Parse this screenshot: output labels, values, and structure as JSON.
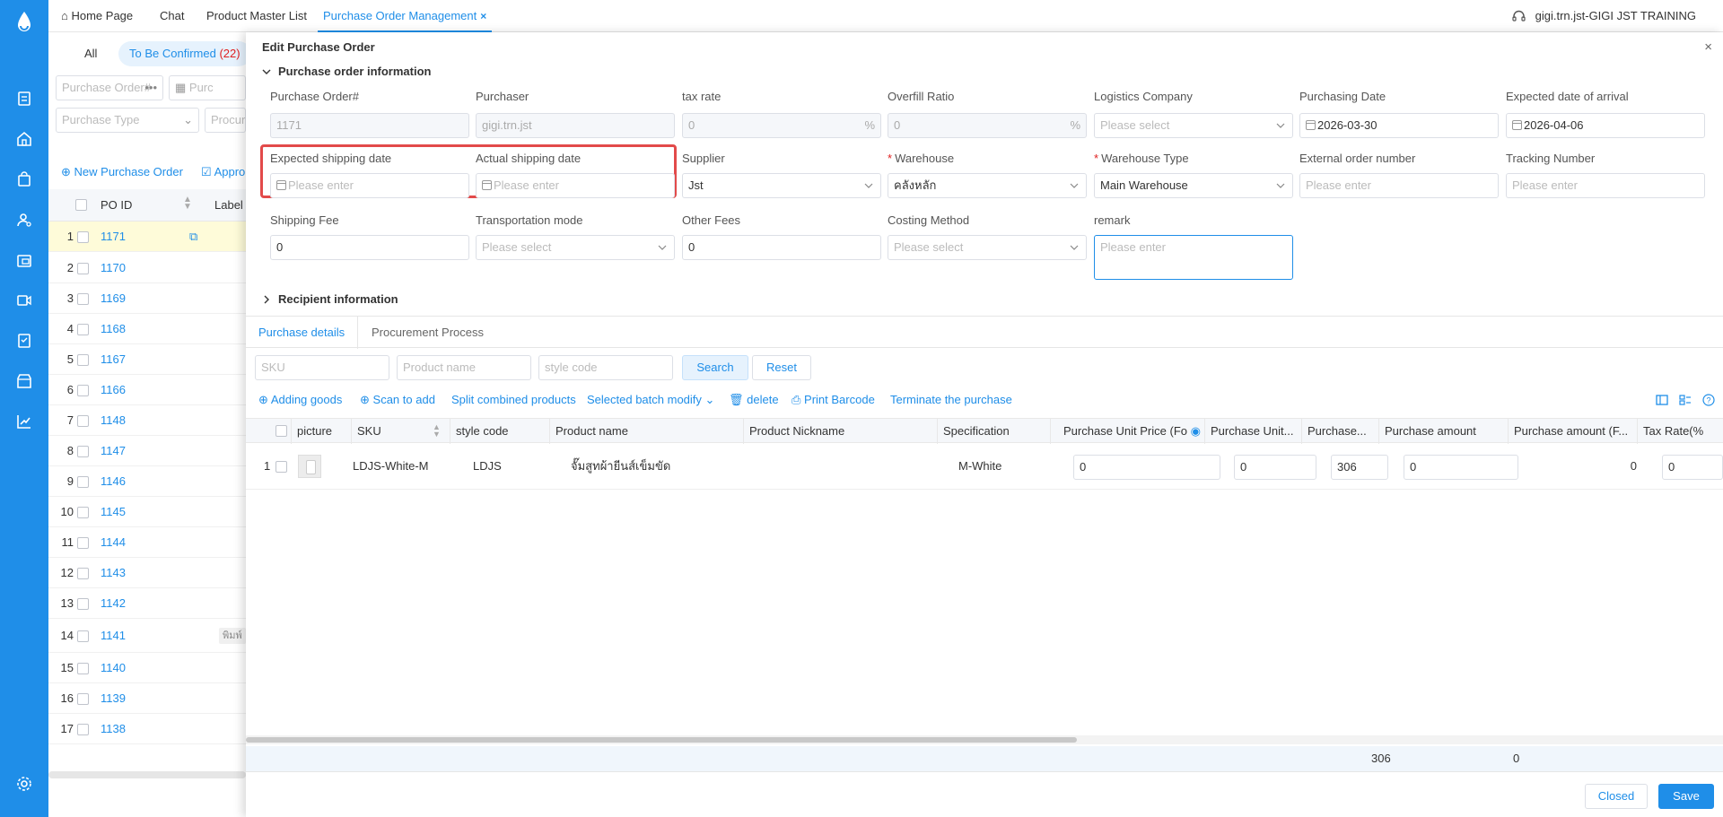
{
  "topbar": {
    "tabs": [
      "Home Page",
      "Chat",
      "Product Master List",
      "Purchase Order Management"
    ],
    "active_tab_close": "×",
    "user": "gigi.trn.jst-GIGI JST TRAINING"
  },
  "list": {
    "filter_all": "All",
    "filter_confirm": "To Be Confirmed",
    "filter_confirm_count": "(22)",
    "po_search_placeholder": "Purchase Order#",
    "date_placeholder": "Purc",
    "type_placeholder": "Purchase Type",
    "procure_placeholder": "Procurem",
    "new_po": "New Purchase Order",
    "approve": "Appro",
    "col_po": "PO ID",
    "col_label": "Label",
    "rows": [
      {
        "n": "1",
        "id": "1171"
      },
      {
        "n": "2",
        "id": "1170"
      },
      {
        "n": "3",
        "id": "1169"
      },
      {
        "n": "4",
        "id": "1168"
      },
      {
        "n": "5",
        "id": "1167"
      },
      {
        "n": "6",
        "id": "1166"
      },
      {
        "n": "7",
        "id": "1148"
      },
      {
        "n": "8",
        "id": "1147"
      },
      {
        "n": "9",
        "id": "1146"
      },
      {
        "n": "10",
        "id": "1145"
      },
      {
        "n": "11",
        "id": "1144"
      },
      {
        "n": "12",
        "id": "1143"
      },
      {
        "n": "13",
        "id": "1142"
      },
      {
        "n": "14",
        "id": "1141",
        "label": "พิมพ์"
      },
      {
        "n": "15",
        "id": "1140"
      },
      {
        "n": "16",
        "id": "1139"
      },
      {
        "n": "17",
        "id": "1138"
      }
    ]
  },
  "drawer": {
    "title": "Edit Purchase Order",
    "close": "×",
    "section_info": "Purchase order information",
    "section_recipient": "Recipient information",
    "fields": {
      "po_label": "Purchase Order#",
      "po_value": "1171",
      "purchaser_label": "Purchaser",
      "purchaser_value": "gigi.trn.jst",
      "tax_label": "tax rate",
      "tax_value": "0",
      "tax_suffix": "%",
      "overfill_label": "Overfill Ratio",
      "overfill_value": "0",
      "overfill_suffix": "%",
      "logistics_label": "Logistics Company",
      "logistics_placeholder": "Please select",
      "pdate_label": "Purchasing Date",
      "pdate_value": "2026-03-30",
      "arrival_label": "Expected date of arrival",
      "arrival_value": "2026-04-06",
      "exp_ship_label": "Expected shipping date",
      "exp_ship_placeholder": "Please enter",
      "act_ship_label": "Actual shipping date",
      "act_ship_placeholder": "Please enter",
      "supplier_label": "Supplier",
      "supplier_value": "Jst",
      "warehouse_label": "Warehouse",
      "warehouse_value": "คลังหลัก",
      "wtype_label": "Warehouse Type",
      "wtype_value": "Main Warehouse",
      "ext_label": "External order number",
      "ext_placeholder": "Please enter",
      "tracking_label": "Tracking Number",
      "tracking_placeholder": "Please enter",
      "shipfee_label": "Shipping Fee",
      "shipfee_value": "0",
      "trans_label": "Transportation mode",
      "trans_placeholder": "Please select",
      "other_label": "Other Fees",
      "other_value": "0",
      "costing_label": "Costing Method",
      "costing_placeholder": "Please select",
      "remark_label": "remark",
      "remark_placeholder": "Please enter",
      "required_mark": "*"
    },
    "detail_tabs": [
      "Purchase details",
      "Procurement Process"
    ],
    "search": {
      "sku_placeholder": "SKU",
      "name_placeholder": "Product name",
      "style_placeholder": "style code",
      "search_btn": "Search",
      "reset_btn": "Reset"
    },
    "toolbar": [
      "Adding goods",
      "Scan to add",
      "Split combined products",
      "Selected batch modify",
      "delete",
      "Print Barcode",
      "Terminate the purchase"
    ],
    "columns": [
      "picture",
      "SKU",
      "style code",
      "Product name",
      "Product Nickname",
      "Specification",
      "Purchase Unit Price (Fo",
      "Purchase Unit...",
      "Purchase...",
      "Purchase amount",
      "Purchase amount (F...",
      "Tax Rate(%"
    ],
    "row": {
      "n": "1",
      "sku": "LDJS-White-M",
      "style": "LDJS",
      "name": "จั๊มสูทผ้ายีนส์เข็มขัด",
      "nickname": "",
      "spec": "M-White",
      "unit_price_fc": "0",
      "unit_price": "0",
      "qty": "306",
      "amount": "0",
      "amount_fc": "0",
      "tax": "0"
    },
    "totals": {
      "qty": "306",
      "amount": "0"
    },
    "footer": {
      "closed": "Closed",
      "save": "Save"
    }
  },
  "colors": {
    "accent": "#1f8ee8",
    "highlight": "#e24a4a",
    "selected_row": "#fefbd9"
  }
}
